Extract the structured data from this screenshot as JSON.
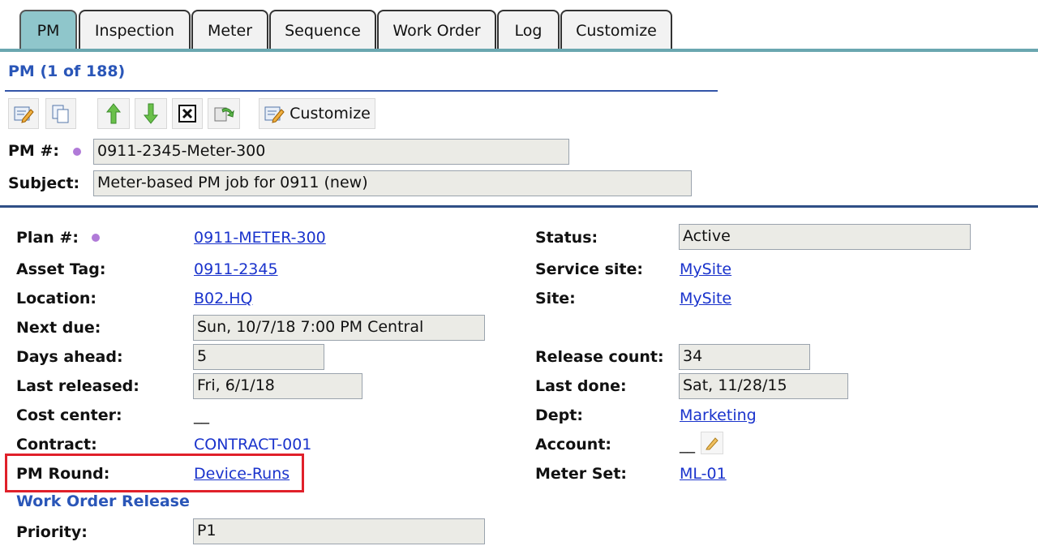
{
  "tabs": [
    "PM",
    "Inspection",
    "Meter",
    "Sequence",
    "Work Order",
    "Log",
    "Customize"
  ],
  "header": {
    "title": "PM (1 of 188)"
  },
  "toolbar": {
    "customize_label": "Customize"
  },
  "pm": {
    "number_label": "PM #:",
    "number_value": "0911-2345-Meter-300",
    "subject_label": "Subject:",
    "subject_value": "Meter-based PM job for 0911 (new)"
  },
  "details": {
    "plan_label": "Plan #:",
    "plan_value": "0911-METER-300",
    "asset_label": "Asset Tag:",
    "asset_value": "0911-2345",
    "location_label": "Location:",
    "location_value": "B02.HQ",
    "next_due_label": "Next due:",
    "next_due_value": "Sun, 10/7/18 7:00 PM Central",
    "days_ahead_label": "Days ahead:",
    "days_ahead_value": "5",
    "last_released_label": "Last released:",
    "last_released_value": "Fri, 6/1/18",
    "cost_center_label": "Cost center:",
    "cost_center_value": "__",
    "contract_label": "Contract:",
    "contract_value": "CONTRACT-001",
    "pm_round_label": "PM Round:",
    "pm_round_value": "Device-Runs",
    "status_label": "Status:",
    "status_value": "Active",
    "service_site_label": "Service site:",
    "service_site_value": "MySite",
    "site_label": "Site:",
    "site_value": "MySite",
    "release_count_label": "Release count:",
    "release_count_value": "34",
    "last_done_label": "Last done:",
    "last_done_value": "Sat, 11/28/15",
    "dept_label": "Dept:",
    "dept_value": "Marketing",
    "account_label": "Account:",
    "account_value": "__",
    "meter_set_label": "Meter Set:",
    "meter_set_value": "ML-01"
  },
  "release": {
    "heading": "Work Order Release",
    "priority_label": "Priority:",
    "priority_value": "P1"
  },
  "colors": {
    "tab_active": "#8fc6cb",
    "link": "#1a33cc",
    "heading": "#2a56b8",
    "highlight": "#e0202a"
  }
}
